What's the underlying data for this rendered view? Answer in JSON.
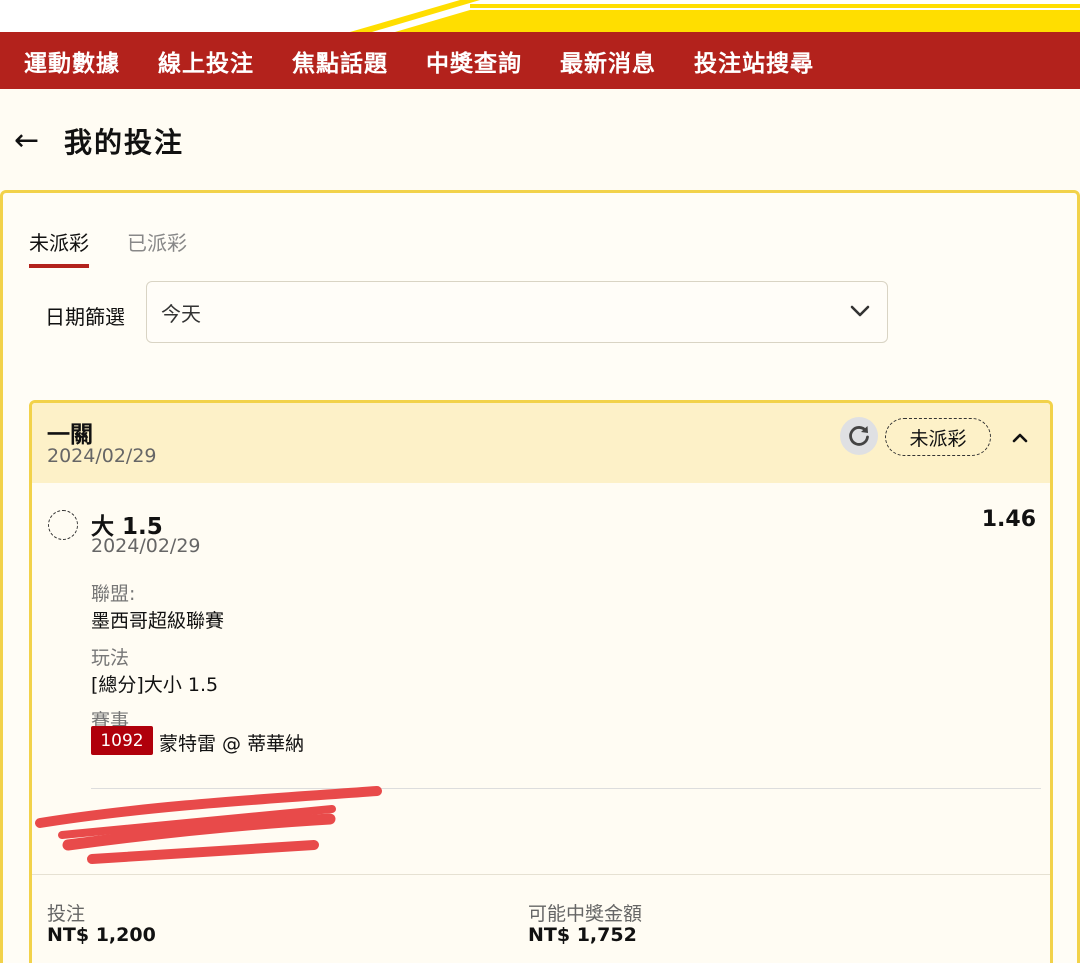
{
  "colors": {
    "brand_red": "#b3221c",
    "accent_yellow": "#f2d24a",
    "badge_red": "#b0000b"
  },
  "nav": {
    "items": [
      {
        "label": "運動數據"
      },
      {
        "label": "線上投注"
      },
      {
        "label": "焦點話題"
      },
      {
        "label": "中獎查詢"
      },
      {
        "label": "最新消息"
      },
      {
        "label": "投注站搜尋"
      }
    ]
  },
  "header": {
    "back_icon": "arrow-left-icon",
    "title": "我的投注"
  },
  "tabs": [
    {
      "label": "未派彩",
      "active": true
    },
    {
      "label": "已派彩",
      "active": false
    }
  ],
  "filter": {
    "label": "日期篩選",
    "selected": "今天",
    "icon": "chevron-down-icon"
  },
  "bet": {
    "type": "一關",
    "date": "2024/02/29",
    "status": "未派彩",
    "selection": {
      "name": "大 1.5",
      "date": "2024/02/29",
      "odds": "1.46",
      "league_label": "聯盟:",
      "league": "墨西哥超級聯賽",
      "market_label": "玩法",
      "market": "[總分]大小 1.5",
      "event_label": "賽事",
      "event_id": "1092",
      "event_name": "蒙特雷 @ 蒂華納"
    },
    "summary": {
      "stake_label": "投注",
      "stake": "NT$ 1,200",
      "payout_label": "可能中獎金額",
      "payout": "NT$ 1,752"
    }
  }
}
